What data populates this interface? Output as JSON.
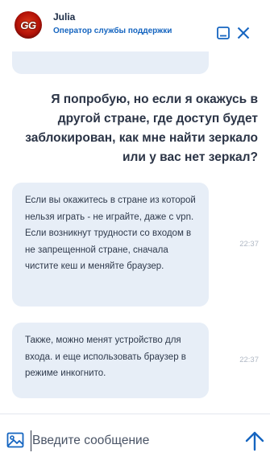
{
  "header": {
    "agent_name": "Julia",
    "agent_role": "Оператор службы поддержки",
    "avatar_text": "GG",
    "minimize_icon": "minimize-window-icon",
    "close_icon": "close-icon"
  },
  "messages": [
    {
      "from": "user",
      "text": "Я попробую, но если я окажусь в другой стране, где доступ будет заблокирован, как мне найти зеркало или у вас нет зеркал?"
    },
    {
      "from": "operator",
      "text": "Если вы окажитесь в стране из которой нельзя играть - не играйте, даже с vpn. Если возникнут трудности со входом в не запрещенной стране, сначала чистите кеш и меняйте браузер.",
      "time": "22:37"
    },
    {
      "from": "operator",
      "text": "Также, можно менят устройство для входа. и еще использовать браузер в режиме инкогнито.",
      "time": "22:37"
    }
  ],
  "composer": {
    "placeholder": "Введите сообщение",
    "attach_icon": "image-attach-icon",
    "send_icon": "send-arrow-icon"
  },
  "colors": {
    "accent": "#1565c0",
    "bubble": "#e7eef7",
    "text": "#2b3446",
    "timestamp": "#b0b8c4"
  }
}
